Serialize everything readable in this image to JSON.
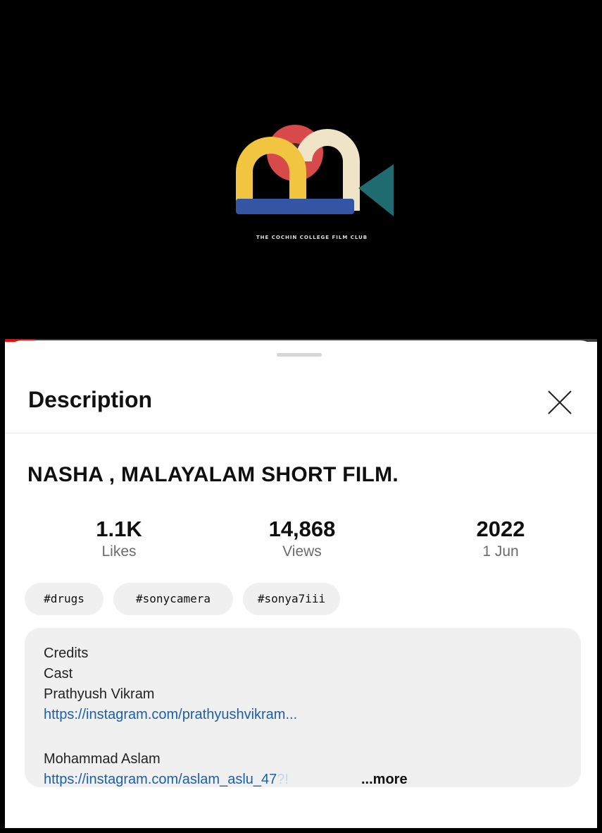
{
  "video": {
    "logo_caption": "THE COCHIN COLLEGE FILM CLUB",
    "progress": 0.05,
    "accent": "#ff0000"
  },
  "sheet": {
    "title": "Description",
    "close_icon": "close-icon"
  },
  "video_title": "NASHA , MALAYALAM SHORT FILM.",
  "stats": [
    {
      "value": "1.1K",
      "label": "Likes"
    },
    {
      "value": "14,868",
      "label": "Views"
    },
    {
      "value": "2022",
      "label": "1 Jun"
    }
  ],
  "tags": [
    "#drugs",
    "#sonycamera",
    "#sonya7iii"
  ],
  "credits": {
    "line1": "Credits",
    "line2": "Cast",
    "line3": "Prathyush Vikram",
    "link1": "https://instagram.com/prathyushvikram...",
    "line4": "Mohammad Aslam",
    "link2": "https://instagram.com/aslam_aslu_47",
    "link2_faded": "?!",
    "more": "...more"
  },
  "colors": {
    "link": "#1a5fa8",
    "chip_bg": "#f0f0f0",
    "muted_text": "#6b6b6b"
  }
}
